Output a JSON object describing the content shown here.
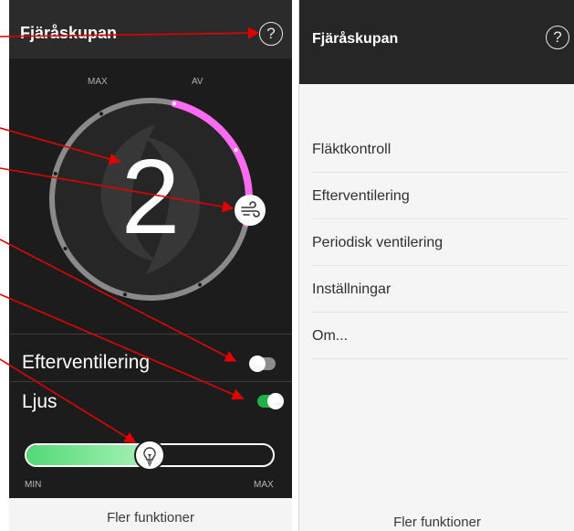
{
  "left_screen": {
    "title": "Fjäråskupan",
    "dial": {
      "max_label": "MAX",
      "off_label": "AV",
      "level": "2"
    },
    "rows": [
      {
        "label": "Efterventilering",
        "enabled": false
      },
      {
        "label": "Ljus",
        "enabled": true
      }
    ],
    "light_slider": {
      "value_fraction": 0.5,
      "min_label": "MIN",
      "max_label": "MAX"
    },
    "footer": "Fler funktioner"
  },
  "right_screen": {
    "title": "Fjäråskupan",
    "menu": [
      {
        "label": "Fläktkontroll"
      },
      {
        "label": "Efterventilering"
      },
      {
        "label": "Periodisk ventilering"
      },
      {
        "label": "Inställningar"
      },
      {
        "label": "Om..."
      }
    ],
    "footer": "Fler funktioner"
  },
  "icons": {
    "help": "question-mark-in-circle",
    "fan": "wind-icon",
    "bulb": "lightbulb-icon"
  },
  "colors": {
    "dial_active": "#ff6bf0",
    "toggle_on": "#1fb04a",
    "slider_fill": "#53d977",
    "annotation_arrow": "#e00000"
  }
}
